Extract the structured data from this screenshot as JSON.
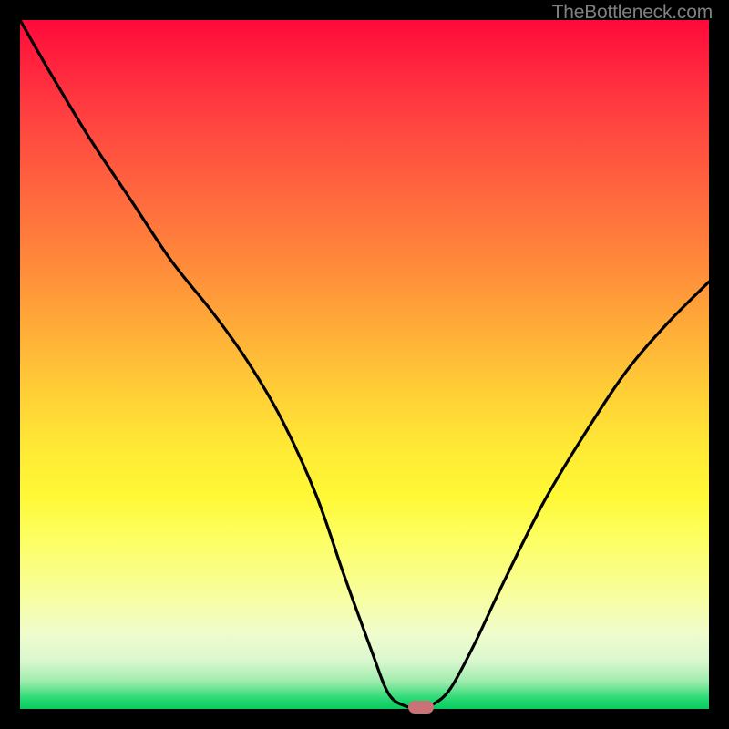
{
  "attribution": "TheBottleneck.com",
  "colors": {
    "marker": "#cb7277",
    "curve": "#000000"
  },
  "chart_data": {
    "type": "line",
    "title": "",
    "xlabel": "",
    "ylabel": "",
    "xlim": [
      0,
      100
    ],
    "ylim": [
      0,
      100
    ],
    "series": [
      {
        "name": "bottleneck-curve",
        "x": [
          0,
          4,
          10,
          16,
          22,
          28,
          33,
          38,
          43,
          47,
          51,
          53.5,
          56,
          58,
          60,
          62.5,
          66,
          70,
          76,
          82,
          88,
          94,
          100
        ],
        "y": [
          100,
          93,
          83,
          74,
          65,
          57.5,
          50.5,
          42,
          31,
          19.5,
          8.5,
          2.2,
          0.4,
          0.3,
          0.7,
          3.0,
          9.5,
          18,
          30,
          40,
          49,
          56,
          62
        ]
      }
    ],
    "marker": {
      "x": 58.2,
      "y": 0.3
    },
    "note": "x and y are in percent of the plot area (0–100); y=0 is the bottom edge."
  }
}
